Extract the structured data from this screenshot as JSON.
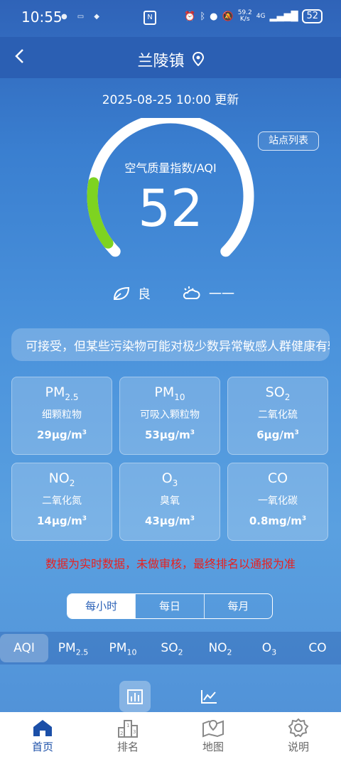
{
  "status_bar": {
    "time": "10:55",
    "net_speed_value": "59.2",
    "net_speed_unit": "K/s",
    "network": "4G",
    "battery": "52",
    "nfc": "N"
  },
  "header": {
    "title": "兰陵镇",
    "back_icon": "chevron-left-icon",
    "location_icon": "map-pin-icon"
  },
  "update_time": "2025-08-25 10:00 更新",
  "station_list_label": "站点列表",
  "aqi": {
    "label": "空气质量指数/AQI",
    "value": "52",
    "level": "良",
    "weather": "一一",
    "gauge_fraction": 0.174,
    "gauge_color": "#7ed321"
  },
  "notice": "可接受，但某些污染物可能对极少数异常敏感人群健康有较弱影响",
  "pollutants": [
    {
      "formula": "PM",
      "sub": "2.5",
      "name": "细颗粒物",
      "value": "29μg/m",
      "sup": "3"
    },
    {
      "formula": "PM",
      "sub": "10",
      "name": "可吸入颗粒物",
      "value": "53μg/m",
      "sup": "3"
    },
    {
      "formula": "SO",
      "sub": "2",
      "name": "二氧化硫",
      "value": "6μg/m",
      "sup": "3"
    },
    {
      "formula": "NO",
      "sub": "2",
      "name": "二氧化氮",
      "value": "14μg/m",
      "sup": "3"
    },
    {
      "formula": "O",
      "sub": "3",
      "name": "臭氧",
      "value": "43μg/m",
      "sup": "3"
    },
    {
      "formula": "CO",
      "sub": "",
      "name": "一氧化碳",
      "value": "0.8mg/m",
      "sup": "3"
    }
  ],
  "warning": "数据为实时数据，未做审核，最终排名以通报为准",
  "period_tabs": [
    "每小时",
    "每日",
    "每月"
  ],
  "pollutant_tabs": [
    {
      "main": "AQI",
      "sub": ""
    },
    {
      "main": "PM",
      "sub": "2.5"
    },
    {
      "main": "PM",
      "sub": "10"
    },
    {
      "main": "SO",
      "sub": "2"
    },
    {
      "main": "NO",
      "sub": "2"
    },
    {
      "main": "O",
      "sub": "3"
    },
    {
      "main": "CO",
      "sub": ""
    }
  ],
  "chart_toggle_icons": [
    "bar-chart-icon",
    "line-chart-icon"
  ],
  "bottom_nav": [
    {
      "label": "首页",
      "icon": "home-icon"
    },
    {
      "label": "排名",
      "icon": "podium-icon"
    },
    {
      "label": "地图",
      "icon": "map-icon"
    },
    {
      "label": "说明",
      "icon": "gear-icon"
    }
  ]
}
